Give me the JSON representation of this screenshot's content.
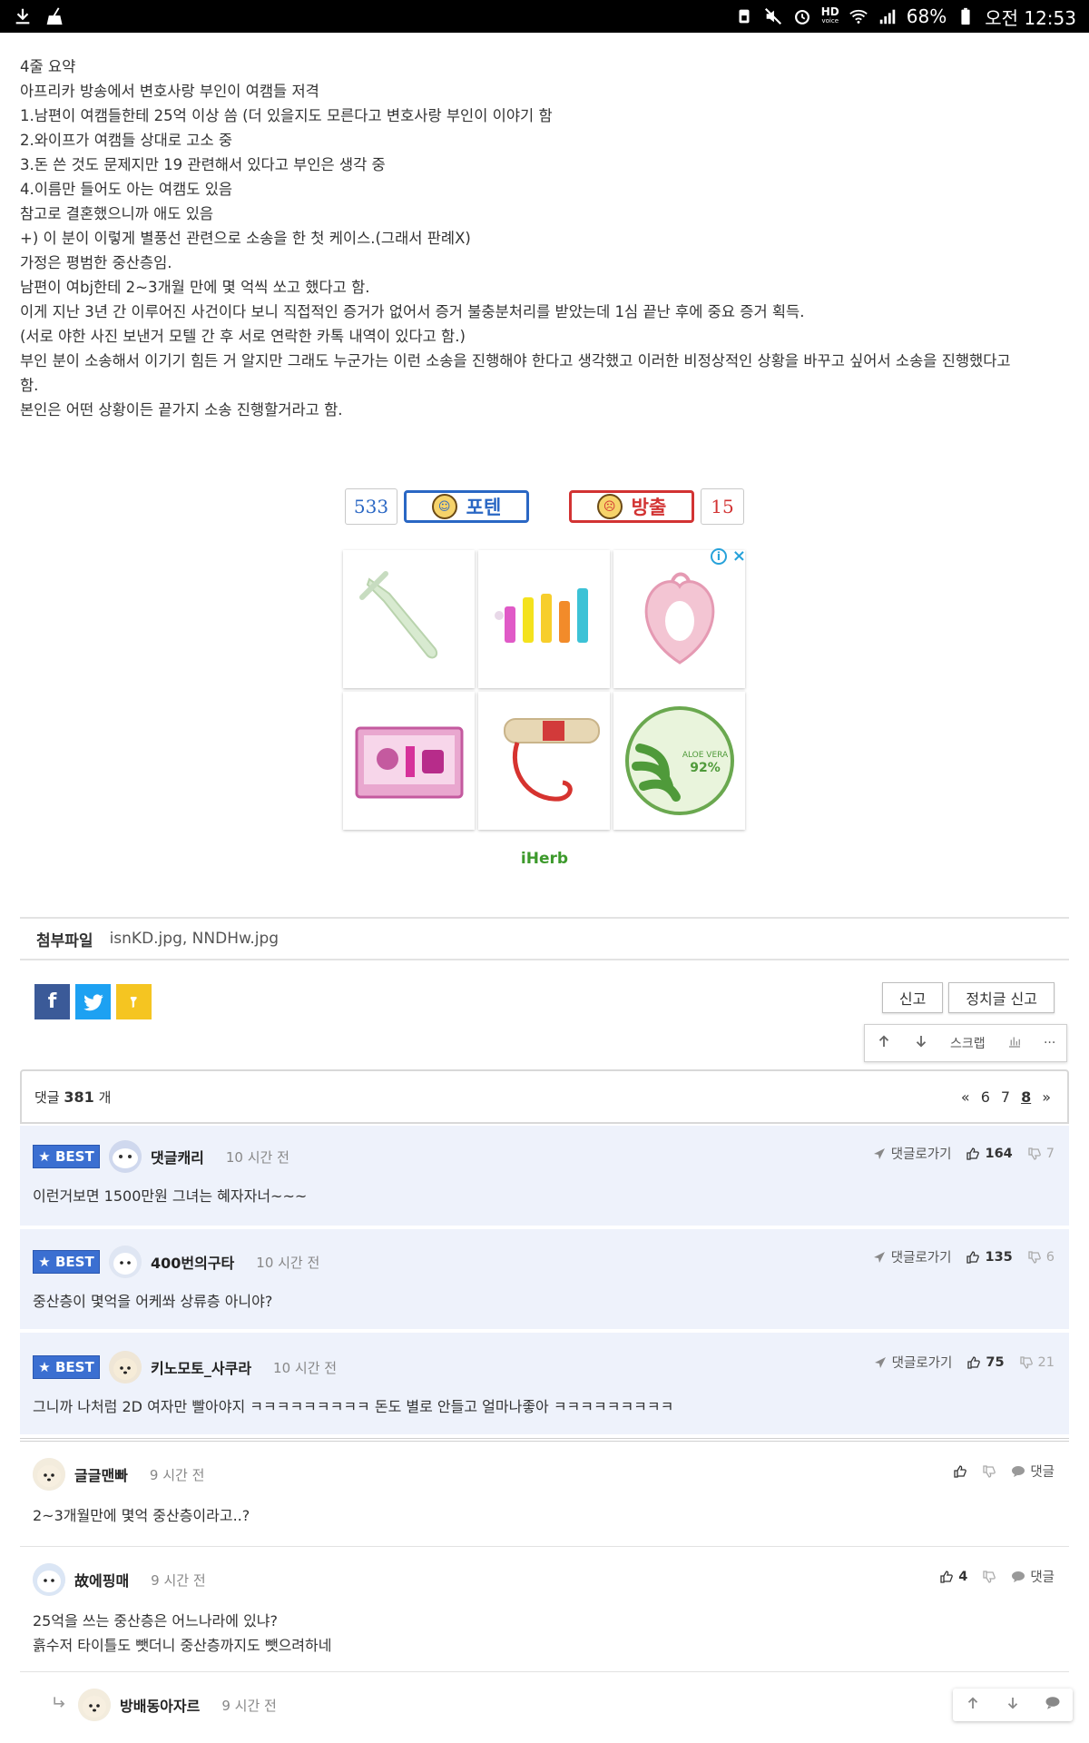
{
  "status_bar": {
    "battery": "68%",
    "clock": "오전 12:53",
    "hd_label": "HD",
    "hd_sub": "voice",
    "left_icons": [
      "download-icon",
      "broom-icon"
    ],
    "right_icons": [
      "sim-icon",
      "mute-icon",
      "alarm-icon",
      "hd-voice-icon",
      "wifi-icon",
      "signal-icon",
      "battery-icon"
    ]
  },
  "article": {
    "lines": [
      "4줄 요약",
      "아프리카 방송에서 변호사랑 부인이 여캠들 저격",
      "1.남편이 여캠들한테 25억 이상 씀 (더 있을지도 모른다고 변호사랑 부인이 이야기 함",
      "2.와이프가 여캠들 상대로 고소 중",
      "3.돈 쓴 것도 문제지만 19 관련해서 있다고 부인은 생각 중",
      "4.이름만 들어도 아는 여캠도 있음",
      "참고로 결혼했으니까 애도 있음",
      "+) 이 분이 이렇게 별풍선 관련으로 소송을 한 첫 케이스.(그래서 판례X)",
      "가정은 평범한 중산층임.",
      "남편이 여bj한테 2~3개월 만에 몇 억씩 쏘고 했다고 함.",
      "이게 지난 3년 간 이루어진 사건이다 보니 직접적인 증거가 없어서 증거 불충분처리를 받았는데 1심 끝난 후에 중요 증거 획득.",
      "(서로 야한 사진 보낸거 모텔 간 후 서로 연락한 카톡 내역이 있다고 함.)",
      "부인 분이 소송해서 이기기 힘든 거 알지만 그래도 누군가는 이런 소송을 진행해야 한다고 생각했고 이러한 비정상적인 상황을 바꾸고 싶어서 소송을 진행했다고",
      "함.",
      "본인은 어떤 상황이든 끝가지 소송 진행할거라고 함."
    ]
  },
  "vote": {
    "up_count": "533",
    "up_label": "포텐",
    "down_label": "방출",
    "down_count": "15"
  },
  "ad": {
    "brand": "iHerb",
    "info_glyph": "i",
    "close_glyph": "×",
    "products": [
      "toothbrush-product",
      "teether-set-product",
      "strawberry-teether-product",
      "baby-care-kit-product",
      "pacifier-clip-product",
      "aloe-gel-product"
    ],
    "aloe_label": "ALOE VERA",
    "aloe_percent": "92%"
  },
  "attachments": {
    "label": "첨부파일",
    "files": "isnKD.jpg,  NNDHw.jpg"
  },
  "share": {
    "facebook": "f",
    "twitter": "t",
    "kakao": "k"
  },
  "report": {
    "report_label": "신고",
    "political_report_label": "정치글 신고"
  },
  "toolbar": {
    "scrap_label": "스크랩",
    "more_label": "···"
  },
  "comments_header": {
    "prefix": "댓글",
    "count": "381",
    "suffix": "개",
    "prev": "«",
    "pages": [
      "6",
      "7",
      "8"
    ],
    "next": "»"
  },
  "best_comments": [
    {
      "badge": "BEST",
      "nick": "댓글캐리",
      "time": "10 시간 전",
      "text": "이런거보면 1500만원 그녀는 혜자자너~~~",
      "goto": "댓글로가기",
      "likes": "164",
      "dislikes": "7"
    },
    {
      "badge": "BEST",
      "nick": "400번의구타",
      "time": "10 시간 전",
      "text": "중산층이 몇억을 어케쏴 상류층 아니야?",
      "goto": "댓글로가기",
      "likes": "135",
      "dislikes": "6"
    },
    {
      "badge": "BEST",
      "nick": "키노모토_사쿠라",
      "time": "10 시간 전",
      "text": "그니까 나처럼 2D 여자만 빨아야지 ㅋㅋㅋㅋㅋㅋㅋㅋㅋ 돈도 별로 안들고 얼마나좋아 ㅋㅋㅋㅋㅋㅋㅋㅋㅋ",
      "goto": "댓글로가기",
      "likes": "75",
      "dislikes": "21"
    }
  ],
  "comments": [
    {
      "nick": "글글맨빠",
      "time": "9 시간 전",
      "text": "2~3개월만에 몇억 중산층이라고..?",
      "likes": "",
      "reply": "댓글"
    },
    {
      "nick": "故에핑매",
      "time": "9 시간 전",
      "text": "25억을 쓰는 중산층은 어느나라에 있냐?",
      "text2": "흙수저 타이틀도 뺏더니 중산층까지도 뺏으려하네",
      "likes": "4",
      "reply": "댓글"
    },
    {
      "nick": "방배동아자르",
      "time": "9 시간 전"
    }
  ],
  "colors": {
    "best_bg": "#eef2fb",
    "best_badge": "#3b6fd1",
    "up": "#2a67c4",
    "down": "#d23333"
  }
}
